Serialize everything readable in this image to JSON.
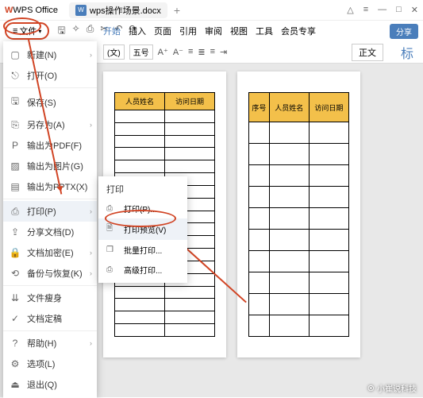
{
  "titlebar": {
    "app": "WPS Office",
    "doc": "wps操作场景.docx",
    "plus": "+"
  },
  "win": {
    "cloud": "△",
    "menu": "≡",
    "min": "—",
    "max": "□",
    "close": "✕"
  },
  "file_btn": "文件",
  "menubar": {
    "start": "开始",
    "insert": "插入",
    "page": "页面",
    "ref": "引用",
    "review": "审阅",
    "view": "视图",
    "tool": "工具",
    "member": "会员专享"
  },
  "share": "分享",
  "ribbon": {
    "font": "(文)",
    "size": "五号",
    "zw": "正文",
    "biao": "标"
  },
  "page1": {
    "h1": "人员姓名",
    "h2": "访问日期"
  },
  "page2": {
    "h1": "序号",
    "h2": "人员姓名",
    "h3": "访问日期"
  },
  "fmenu": {
    "new": "新建(N)",
    "open": "打开(O)",
    "save": "保存(S)",
    "saveas": "另存为(A)",
    "pdf": "输出为PDF(F)",
    "img": "输出为图片(G)",
    "pptx": "输出为PPTX(X)",
    "print": "打印(P)",
    "share": "分享文档(D)",
    "encrypt": "文档加密(E)",
    "backup": "备份与恢复(K)",
    "slim": "文件瘦身",
    "fix": "文档定稿",
    "help": "帮助(H)",
    "option": "选项(L)",
    "exit": "退出(Q)"
  },
  "sub": {
    "head": "打印",
    "p": "打印(P)...",
    "pv": "打印预览(V)",
    "batch": "批量打印...",
    "adv": "高级打印..."
  },
  "watermark": "小崔说科技"
}
